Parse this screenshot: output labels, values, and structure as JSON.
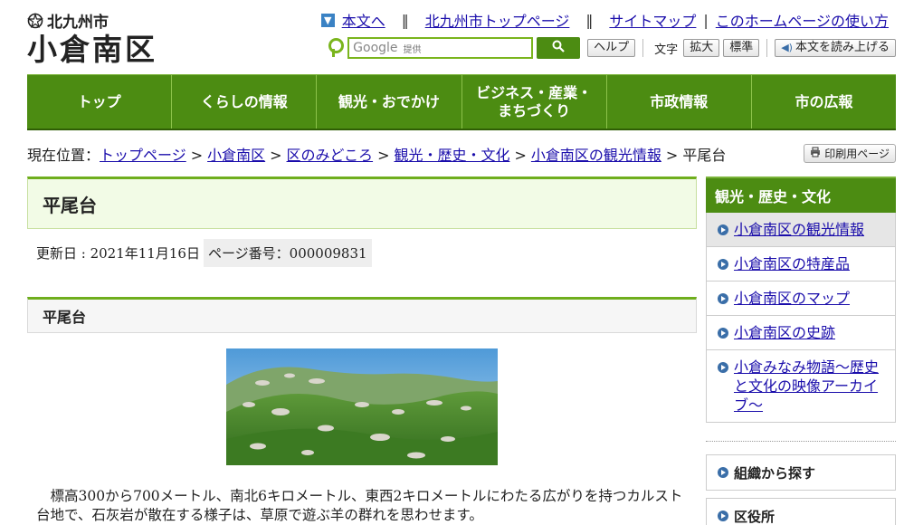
{
  "header": {
    "city_name": "北九州市",
    "ward_name": "小倉南区",
    "top_links": [
      "本文へ",
      "北九州市トップページ",
      "サイトマップ",
      "このホームページの使い方"
    ],
    "search_brand": "Google",
    "search_provided": "提供",
    "help_label": "ヘルプ",
    "text_label": "文字",
    "enlarge_label": "拡大",
    "standard_label": "標準",
    "read_aloud_label": "本文を読み上げる"
  },
  "nav": [
    "トップ",
    "くらしの情報",
    "観光・おでかけ",
    "ビジネス・産業・\nまちづくり",
    "市政情報",
    "市の広報"
  ],
  "breadcrumb": {
    "prefix": "現在位置：",
    "links": [
      "トップページ",
      "小倉南区",
      "区のみどころ",
      "観光・歴史・文化",
      "小倉南区の観光情報"
    ],
    "current": "平尾台"
  },
  "print_label": "印刷用ページ",
  "page": {
    "title": "平尾台",
    "updated": "更新日 : 2021年11月16日",
    "page_number": "ページ番号：000009831",
    "section_title": "平尾台",
    "body": "標高300から700メートル、南北6キロメートル、東西2キロメートルにわたる広がりを持つカルスト台地で、石灰岩が散在する様子は、草原で遊ぶ羊の群れを思わせます。"
  },
  "sidebar": {
    "heading": "観光・歴史・文化",
    "items": [
      "小倉南区の観光情報",
      "小倉南区の特産品",
      "小倉南区のマップ",
      "小倉南区の史跡",
      "小倉みなみ物語～歴史と文化の映像アーカイブ～"
    ],
    "boxes": [
      "組織から探す",
      "区役所"
    ]
  },
  "colors": {
    "primary_green": "#4c8c12",
    "link": "#1a0dab"
  }
}
